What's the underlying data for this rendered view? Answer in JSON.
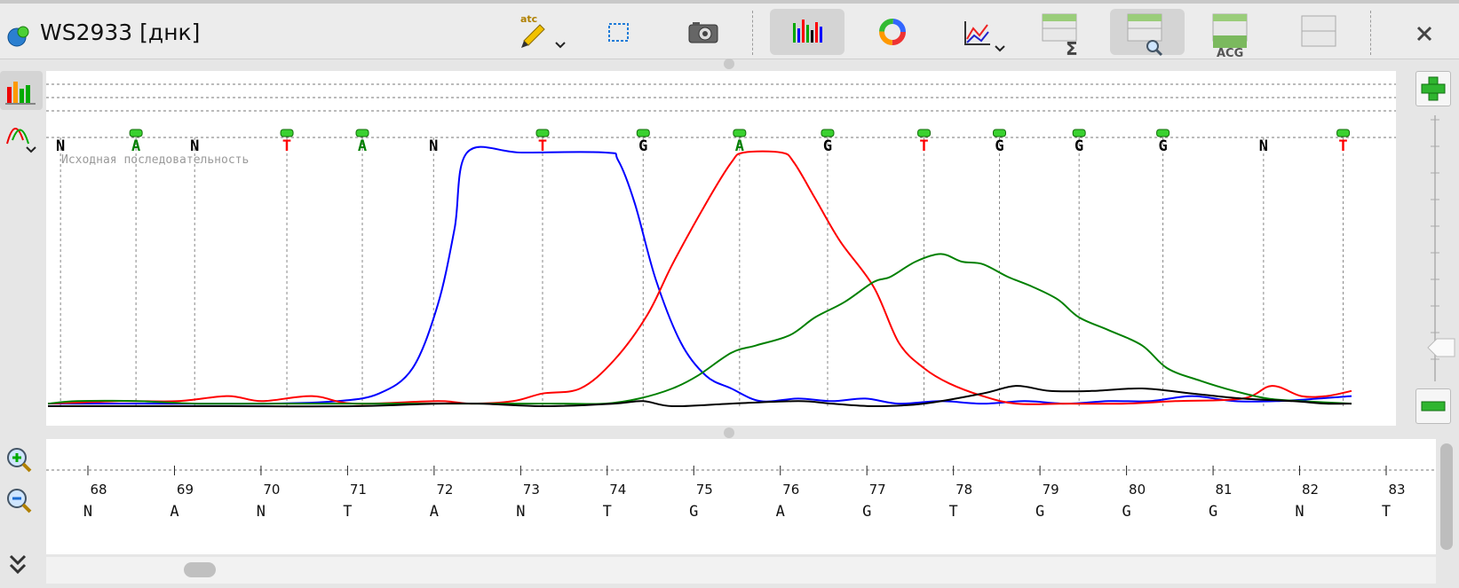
{
  "window": {
    "title": "WS2933 [днк]"
  },
  "toolbar": {
    "buttons": [
      {
        "name": "annotate",
        "icon": "pencil-atc-icon",
        "label": "atc",
        "active": false
      },
      {
        "name": "select",
        "icon": "selection-rect-icon",
        "active": false
      },
      {
        "name": "snapshot",
        "icon": "camera-icon",
        "active": false
      },
      {
        "name": "chromatogram",
        "icon": "chromatogram-icon",
        "active": true
      },
      {
        "name": "color-wheel",
        "icon": "color-wheel-icon",
        "active": false
      },
      {
        "name": "graph-menu",
        "icon": "chart-icon",
        "active": false
      },
      {
        "name": "sum-panel",
        "icon": "sum-panel-icon",
        "label": "Σ",
        "active": false
      },
      {
        "name": "zoom-panel",
        "icon": "magnify-panel-icon",
        "active": true
      },
      {
        "name": "acg-panel",
        "icon": "acg-panel-icon",
        "label": "ACG",
        "active": false
      },
      {
        "name": "plain-panel",
        "icon": "panel-icon",
        "active": false
      }
    ],
    "close_icon": "close-icon"
  },
  "left_tools": [
    {
      "name": "bars-view",
      "icon": "bar-chart-icon",
      "active": true
    },
    {
      "name": "curve-view",
      "icon": "curve-icon",
      "active": false
    },
    {
      "name": "zoom-in",
      "icon": "zoom-in-icon"
    },
    {
      "name": "zoom-out",
      "icon": "zoom-out-icon"
    },
    {
      "name": "expand",
      "icon": "double-chevron-down-icon"
    }
  ],
  "right_tools": [
    {
      "name": "add",
      "icon": "plus-icon"
    },
    {
      "name": "remove",
      "icon": "minus-icon"
    }
  ],
  "chart_data": {
    "type": "line",
    "title": "",
    "caption": "Исходная последовательность",
    "colors": {
      "A": "#008000",
      "T": "#ff0000",
      "G": "#000000",
      "C": "#0000ff"
    },
    "called_bases": [
      {
        "base": "N",
        "color": "#000000",
        "marker": false,
        "x": 68.0
      },
      {
        "base": "A",
        "color": "#008000",
        "marker": true,
        "x": 68.9
      },
      {
        "base": "N",
        "color": "#000000",
        "marker": false,
        "x": 69.6
      },
      {
        "base": "T",
        "color": "#ff0000",
        "marker": true,
        "x": 70.7
      },
      {
        "base": "A",
        "color": "#008000",
        "marker": true,
        "x": 71.6
      },
      {
        "base": "N",
        "color": "#000000",
        "marker": false,
        "x": 72.45
      },
      {
        "base": "T",
        "color": "#ff0000",
        "marker": true,
        "x": 73.75
      },
      {
        "base": "G",
        "color": "#000000",
        "marker": true,
        "x": 74.95
      },
      {
        "base": "A",
        "color": "#008000",
        "marker": true,
        "x": 76.1
      },
      {
        "base": "G",
        "color": "#000000",
        "marker": true,
        "x": 77.15
      },
      {
        "base": "T",
        "color": "#ff0000",
        "marker": true,
        "x": 78.3
      },
      {
        "base": "G",
        "color": "#000000",
        "marker": true,
        "x": 79.2
      },
      {
        "base": "G",
        "color": "#000000",
        "marker": true,
        "x": 80.15
      },
      {
        "base": "G",
        "color": "#000000",
        "marker": true,
        "x": 81.15
      },
      {
        "base": "N",
        "color": "#000000",
        "marker": false,
        "x": 82.35
      },
      {
        "base": "T",
        "color": "#ff0000",
        "marker": true,
        "x": 83.3
      }
    ],
    "xlim": [
      67.85,
      83.4
    ],
    "ylim": [
      0,
      100
    ],
    "series": [
      {
        "base": "C",
        "color": "#0000ff",
        "points": [
          [
            67.85,
            1
          ],
          [
            69,
            1
          ],
          [
            70.5,
            1
          ],
          [
            71.3,
            2
          ],
          [
            71.8,
            5
          ],
          [
            72.2,
            15
          ],
          [
            72.5,
            40
          ],
          [
            72.7,
            70
          ],
          [
            72.85,
            100
          ],
          [
            73.5,
            100
          ],
          [
            74.5,
            100
          ],
          [
            74.65,
            97
          ],
          [
            74.85,
            80
          ],
          [
            75.1,
            50
          ],
          [
            75.4,
            25
          ],
          [
            75.7,
            12
          ],
          [
            76,
            7
          ],
          [
            76.35,
            2
          ],
          [
            76.8,
            3
          ],
          [
            77.2,
            2
          ],
          [
            77.6,
            3
          ],
          [
            78,
            1
          ],
          [
            78.5,
            2
          ],
          [
            79,
            1
          ],
          [
            79.5,
            2
          ],
          [
            80,
            1
          ],
          [
            80.5,
            2
          ],
          [
            81,
            2
          ],
          [
            81.5,
            4
          ],
          [
            82,
            2
          ],
          [
            82.5,
            2
          ],
          [
            83,
            3
          ],
          [
            83.4,
            4
          ]
        ]
      },
      {
        "base": "T",
        "color": "#ff0000",
        "points": [
          [
            67.85,
            1
          ],
          [
            68.7,
            2
          ],
          [
            69.4,
            2
          ],
          [
            70,
            4
          ],
          [
            70.4,
            2
          ],
          [
            71,
            4
          ],
          [
            71.5,
            1
          ],
          [
            72.5,
            2
          ],
          [
            72.9,
            1
          ],
          [
            73.4,
            2
          ],
          [
            73.75,
            5
          ],
          [
            74.2,
            7
          ],
          [
            74.6,
            18
          ],
          [
            75,
            36
          ],
          [
            75.3,
            56
          ],
          [
            75.7,
            80
          ],
          [
            76,
            96
          ],
          [
            76.15,
            100
          ],
          [
            76.6,
            100
          ],
          [
            76.75,
            96
          ],
          [
            77,
            82
          ],
          [
            77.3,
            65
          ],
          [
            77.7,
            47
          ],
          [
            78,
            25
          ],
          [
            78.3,
            15
          ],
          [
            78.6,
            9
          ],
          [
            79,
            4
          ],
          [
            79.4,
            1
          ],
          [
            80,
            1
          ],
          [
            80.7,
            1
          ],
          [
            81.3,
            2
          ],
          [
            82.1,
            3
          ],
          [
            82.45,
            8
          ],
          [
            82.8,
            4
          ],
          [
            83.1,
            4
          ],
          [
            83.4,
            6
          ]
        ]
      },
      {
        "base": "A",
        "color": "#008000",
        "points": [
          [
            67.85,
            1
          ],
          [
            68.2,
            2
          ],
          [
            68.9,
            2
          ],
          [
            69.6,
            1
          ],
          [
            70.3,
            1
          ],
          [
            71,
            1
          ],
          [
            72,
            1
          ],
          [
            72.8,
            1
          ],
          [
            73.3,
            1
          ],
          [
            74,
            1
          ],
          [
            74.5,
            1
          ],
          [
            74.9,
            3
          ],
          [
            75.3,
            7
          ],
          [
            75.6,
            12
          ],
          [
            76,
            21
          ],
          [
            76.3,
            24
          ],
          [
            76.7,
            28
          ],
          [
            77,
            35
          ],
          [
            77.35,
            41
          ],
          [
            77.7,
            49
          ],
          [
            77.9,
            51
          ],
          [
            78.2,
            57
          ],
          [
            78.5,
            60
          ],
          [
            78.75,
            57
          ],
          [
            79,
            56
          ],
          [
            79.3,
            51
          ],
          [
            79.6,
            47
          ],
          [
            79.9,
            42
          ],
          [
            80.15,
            35
          ],
          [
            80.5,
            30
          ],
          [
            80.9,
            24
          ],
          [
            81.2,
            15
          ],
          [
            81.6,
            10
          ],
          [
            82,
            6
          ],
          [
            82.4,
            3
          ],
          [
            82.8,
            2
          ],
          [
            83.4,
            1
          ]
        ]
      },
      {
        "base": "G",
        "color": "#000000",
        "points": [
          [
            67.85,
            0
          ],
          [
            69,
            0
          ],
          [
            70,
            0
          ],
          [
            71.5,
            0
          ],
          [
            72.5,
            1
          ],
          [
            73,
            1
          ],
          [
            73.8,
            0
          ],
          [
            74.6,
            1
          ],
          [
            74.95,
            2
          ],
          [
            75.3,
            0
          ],
          [
            76,
            1
          ],
          [
            76.8,
            2
          ],
          [
            77.2,
            1
          ],
          [
            77.7,
            0
          ],
          [
            78.3,
            1
          ],
          [
            79,
            5
          ],
          [
            79.4,
            8
          ],
          [
            79.8,
            6
          ],
          [
            80.3,
            6
          ],
          [
            80.9,
            7
          ],
          [
            81.5,
            5
          ],
          [
            82.1,
            3
          ],
          [
            82.7,
            2
          ],
          [
            83.1,
            1
          ],
          [
            83.4,
            1
          ]
        ]
      }
    ],
    "dashed_levels": 4
  },
  "ruler": {
    "positions": [
      68,
      69,
      70,
      71,
      72,
      73,
      74,
      75,
      76,
      77,
      78,
      79,
      80,
      81,
      82,
      83
    ],
    "sequence": [
      "N",
      "A",
      "N",
      "T",
      "A",
      "N",
      "T",
      "G",
      "A",
      "G",
      "T",
      "G",
      "G",
      "G",
      "N",
      "T"
    ]
  },
  "scroll": {
    "h_fraction": 0.08
  }
}
